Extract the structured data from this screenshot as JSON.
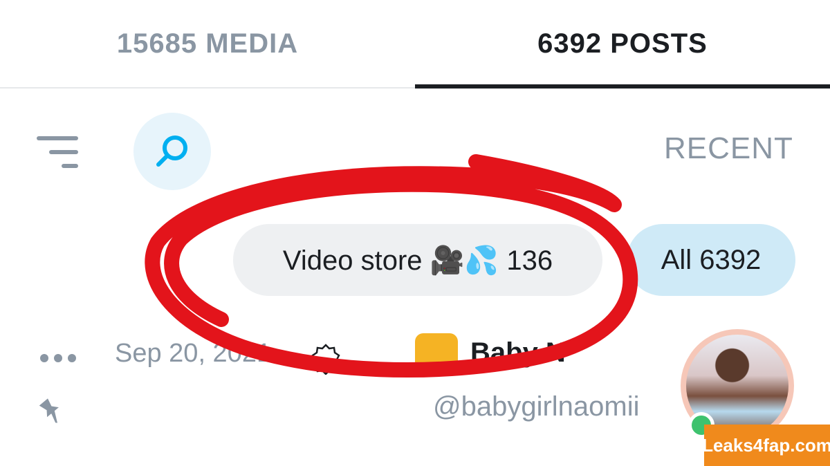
{
  "tabs": {
    "posts_label": "6392 POSTS",
    "media_label": "15685 MEDIA",
    "active": "posts"
  },
  "filter": {
    "sort_label": "RECENT",
    "search_icon": "search-icon",
    "menu_icon": "filter-lines-icon"
  },
  "chips": {
    "all_label": "All 6392",
    "video_store_label": "Video store 🎥💦 136"
  },
  "post": {
    "display_name": "Baby N",
    "handle": "@babygirlnaomii",
    "date": "Sep 20, 2021",
    "online": true
  },
  "watermark": {
    "text": "Leaks4fap.com"
  },
  "colors": {
    "accent": "#00aff0",
    "active_text": "#1b1e22",
    "muted_text": "#8a96a3",
    "annotation_red": "#e3141b",
    "watermark_bg": "#f08a1c"
  }
}
